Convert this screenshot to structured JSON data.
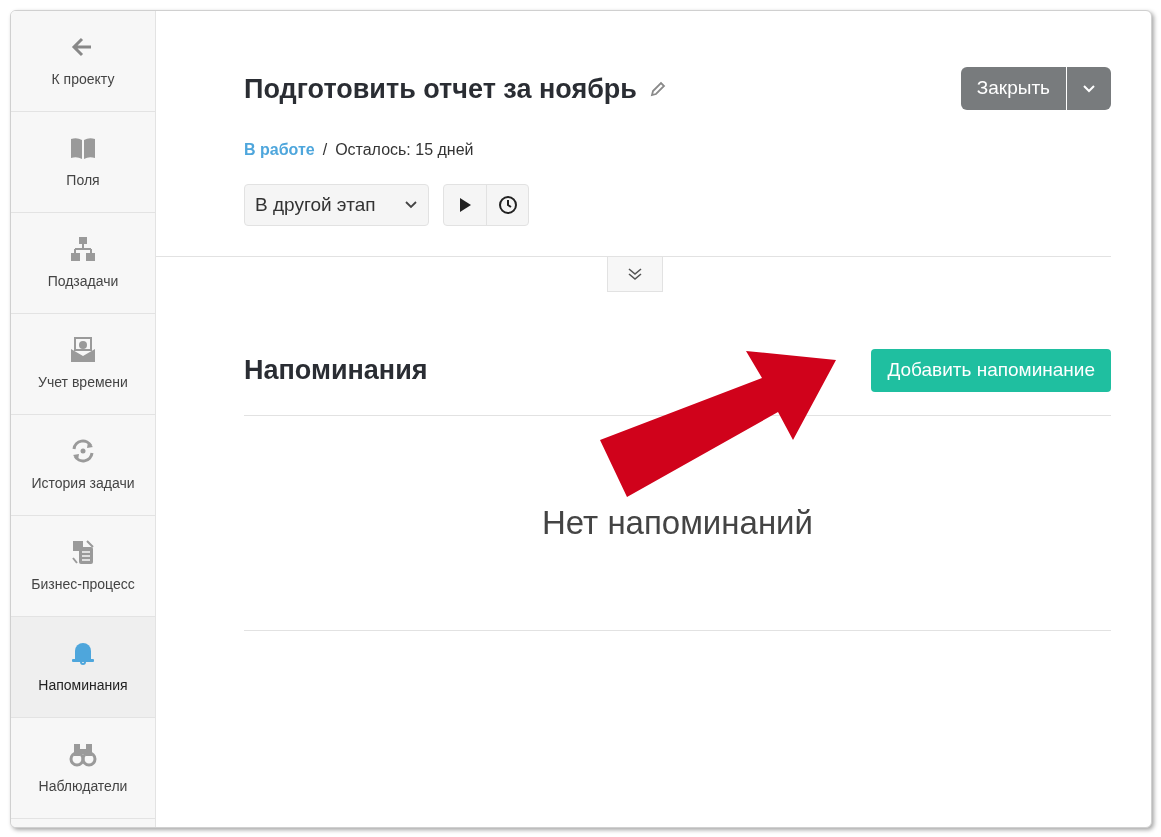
{
  "sidebar": {
    "items": [
      {
        "kind": "back",
        "label": "К проекту",
        "selected": false
      },
      {
        "kind": "fields",
        "label": "Поля",
        "selected": false
      },
      {
        "kind": "subtasks",
        "label": "Подзадачи",
        "selected": false
      },
      {
        "kind": "time",
        "label": "Учет времени",
        "selected": false
      },
      {
        "kind": "history",
        "label": "История задачи",
        "selected": false
      },
      {
        "kind": "process",
        "label": "Бизнес-процесс",
        "selected": false
      },
      {
        "kind": "reminders",
        "label": "Напоминания",
        "selected": true
      },
      {
        "kind": "watchers",
        "label": "Наблюдатели",
        "selected": false
      }
    ]
  },
  "task": {
    "title": "Подготовить отчет за ноябрь",
    "status": "В работе",
    "separator": "/",
    "remaining": "Осталось: 15 дней",
    "stage_button": "В другой этап",
    "close_button": "Закрыть"
  },
  "reminders": {
    "heading": "Напоминания",
    "add_button": "Добавить напоминание",
    "empty_text": "Нет напоминаний"
  }
}
